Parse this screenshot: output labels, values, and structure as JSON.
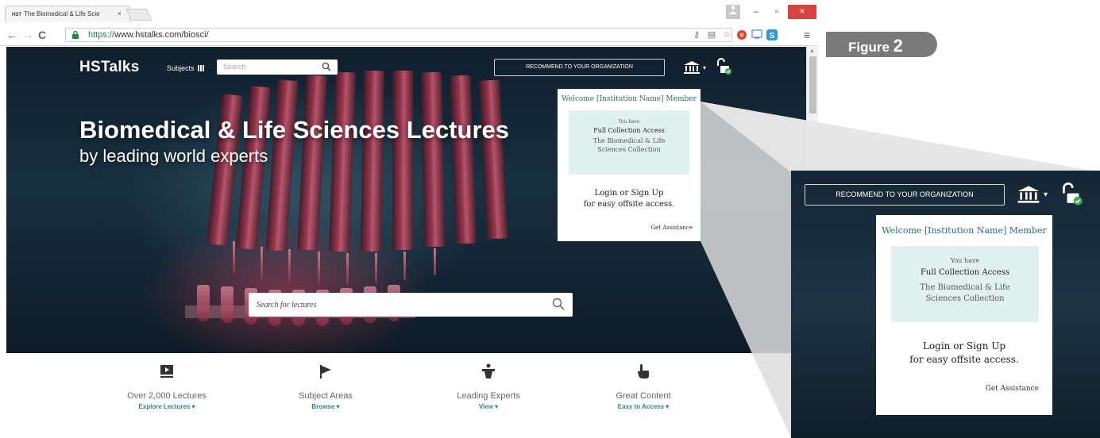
{
  "browser": {
    "tab_badge": "HST",
    "tab_title": "The Biomedical & Life Scie",
    "tab_close": "×",
    "url_https": "https://",
    "url_rest": "www.hstalks.com/biosci/",
    "win_minimize": "–",
    "win_restore": "▫",
    "win_close": "×",
    "back": "←",
    "forward": "→",
    "reload": "C",
    "menu": "≡"
  },
  "site": {
    "logo": "HSTalks",
    "subjects_label": "Subjects",
    "search_placeholder": "Search",
    "recommend_label": "RECOMMEND TO YOUR ORGANIZATION",
    "caret": "▾"
  },
  "hero": {
    "title": "Biomedical & Life Sciences Lectures",
    "subtitle": "by leading world experts",
    "search_placeholder": "Search for lectures"
  },
  "welcome": {
    "title": "Welcome [Institution Name] Member",
    "you_have": "You have",
    "full_access": "Full Collection Access",
    "collection_line1": "The Biomedical & Life",
    "collection_line2": "Sciences Collection",
    "login_line": "Login or Sign Up",
    "offsite_line": "for easy offsite access.",
    "assistance": "Get Assistance"
  },
  "features": [
    {
      "icon": "video-lecture-icon",
      "label": "Over 2,000 Lectures",
      "link": "Explore Lectures ▾"
    },
    {
      "icon": "flag-icon",
      "label": "Subject Areas",
      "link": "Browse ▾"
    },
    {
      "icon": "speaker-podium-icon",
      "label": "Leading Experts",
      "link": "View ▾"
    },
    {
      "icon": "hand-pointer-icon",
      "label": "Great Content",
      "link": "Easy to Access ▾"
    }
  ],
  "figure": {
    "prefix": "Figure ",
    "number": "2"
  },
  "colors": {
    "accent_teal": "#2c8a7f",
    "welcome_title": "#2a6e67",
    "access_box": "#e1f1f0",
    "hero_dark": "#173040",
    "figure_badge": "#7a7a7a",
    "window_close": "#d9423d"
  }
}
